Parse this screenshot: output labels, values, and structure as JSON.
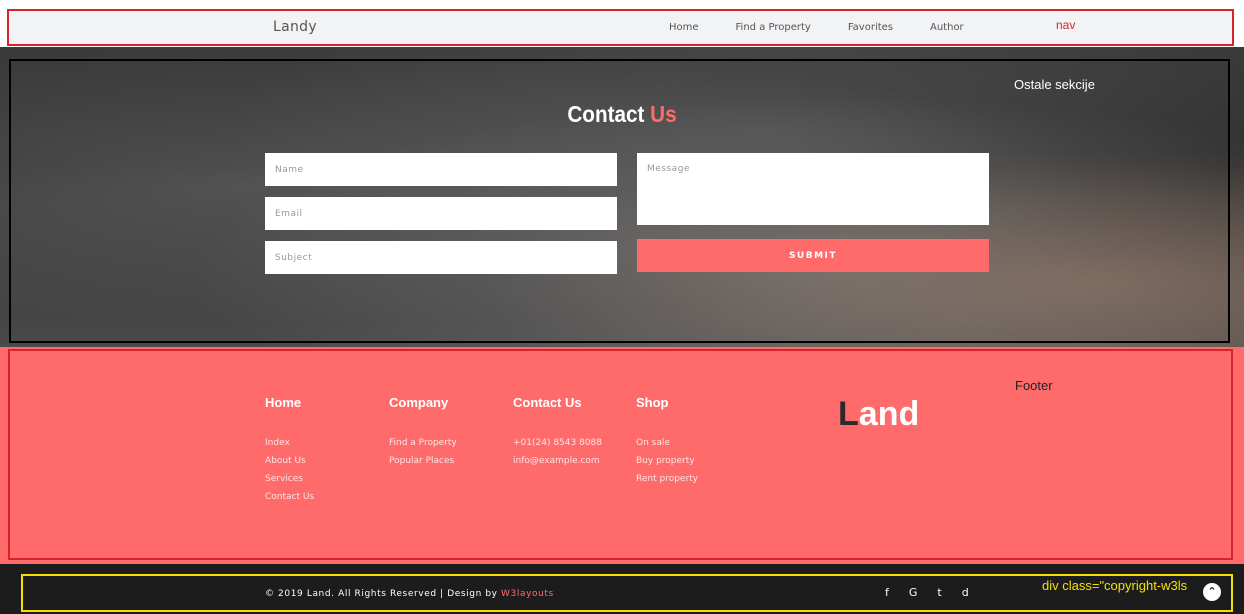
{
  "nav": {
    "brand": "Landy",
    "links": [
      "Home",
      "Find a Property",
      "Favorites",
      "Author"
    ],
    "annotation": "nav"
  },
  "hero": {
    "title_main": "Contact",
    "title_accent": "Us",
    "annotation": "Ostale sekcije",
    "form": {
      "name_placeholder": "Name",
      "email_placeholder": "Email",
      "subject_placeholder": "Subject",
      "message_placeholder": "Message",
      "submit_label": "SUBMIT"
    }
  },
  "footer": {
    "annotation": "Footer",
    "columns": [
      {
        "heading": "Home",
        "links": [
          "Index",
          "About Us",
          "Services",
          "Contact Us"
        ]
      },
      {
        "heading": "Company",
        "links": [
          "Find a Property",
          "Popular Places"
        ]
      },
      {
        "heading": "Contact Us",
        "links": [
          "+01(24) 8543 8088",
          "info@example.com"
        ]
      },
      {
        "heading": "Shop",
        "links": [
          "On sale",
          "Buy property",
          "Rent property"
        ]
      }
    ],
    "logo_first": "L",
    "logo_rest": "and"
  },
  "copyright": {
    "text": "© 2019 Land. All Rights Reserved | Design by ",
    "design_link": "W3layouts",
    "annotation": "div class=\"copyright-w3ls",
    "social": [
      "f",
      "G",
      "t",
      "d"
    ],
    "social_icons": [
      "facebook-icon",
      "google-plus-icon",
      "twitter-icon",
      "dribbble-icon"
    ],
    "to_top_icon": "chevron-double-up-icon"
  },
  "colors": {
    "accent": "#ff6b6b",
    "outline_red": "#d9232b",
    "outline_yellow": "#f4e000"
  }
}
